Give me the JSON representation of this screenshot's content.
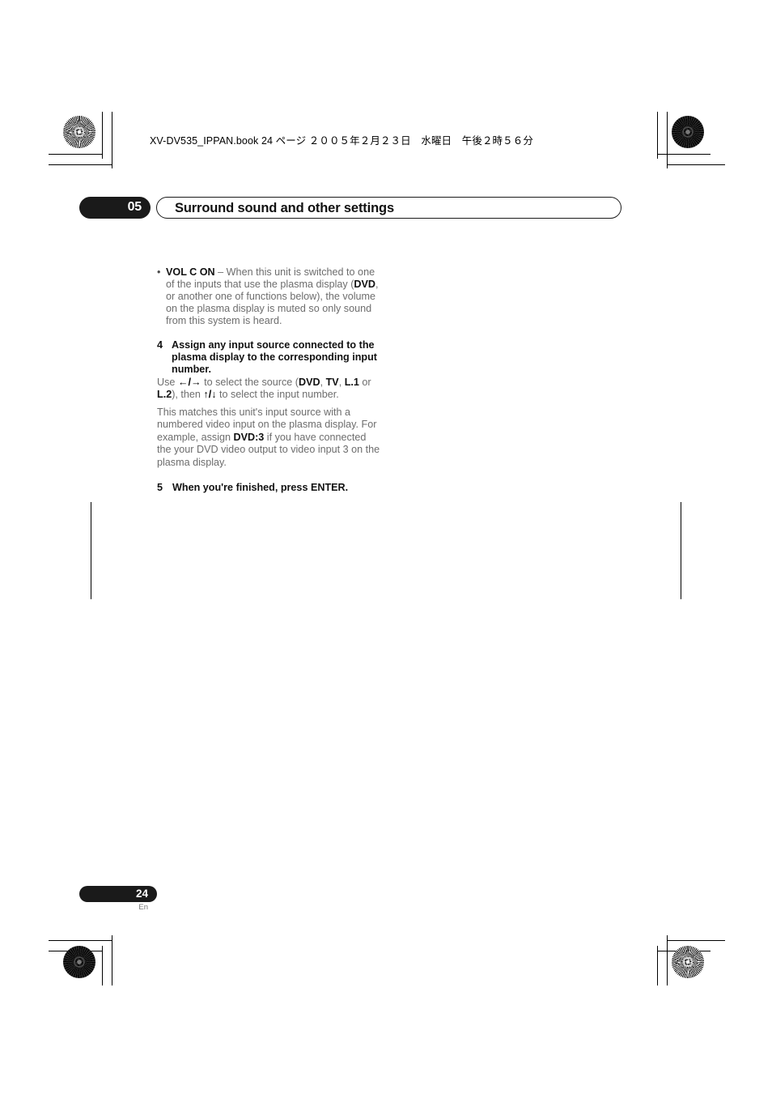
{
  "document": {
    "running_header": "XV-DV535_IPPAN.book 24 ページ ２００５年２月２３日　水曜日　午後２時５６分",
    "chapter_number": "05",
    "chapter_title": "Surround sound and other settings",
    "page_number": "24",
    "language_code": "En"
  },
  "content": {
    "bullet": {
      "marker": "•",
      "term": "VOL C ON",
      "dash": " – ",
      "text_part1": "When this unit is switched to one of the inputs that use the plasma display (",
      "term2": "DVD",
      "text_part2": ", or another one of functions below), the volume on the plasma display is muted so only sound from this system is heard."
    },
    "step4": {
      "number": "4",
      "heading": "Assign any input source connected to the plasma display to the corresponding input number.",
      "instruction_pre": "Use ",
      "arrows_lr": "←/→",
      "instruction_mid": " to select the source (",
      "source_dvd": "DVD",
      "sep1": ", ",
      "source_tv": "TV",
      "sep2": ", ",
      "source_l1": "L.1",
      "instruction_or": " or ",
      "source_l2": "L.2",
      "instruction_then": "), then ",
      "arrows_ud": "↑/↓",
      "instruction_end": " to select the input number.",
      "paragraph_pre": "This matches this unit's input source with a numbered video input on the plasma display. For example, assign ",
      "paragraph_term": "DVD:3",
      "paragraph_post": " if you have connected the your DVD video output to video input 3 on the plasma display."
    },
    "step5": {
      "number": "5",
      "heading": "When you're finished, press ENTER."
    }
  },
  "colors": {
    "body_text": "#6d6d6d",
    "bold_text": "#111111",
    "pill_background": "#1a1a1a",
    "pill_text": "#ffffff"
  }
}
